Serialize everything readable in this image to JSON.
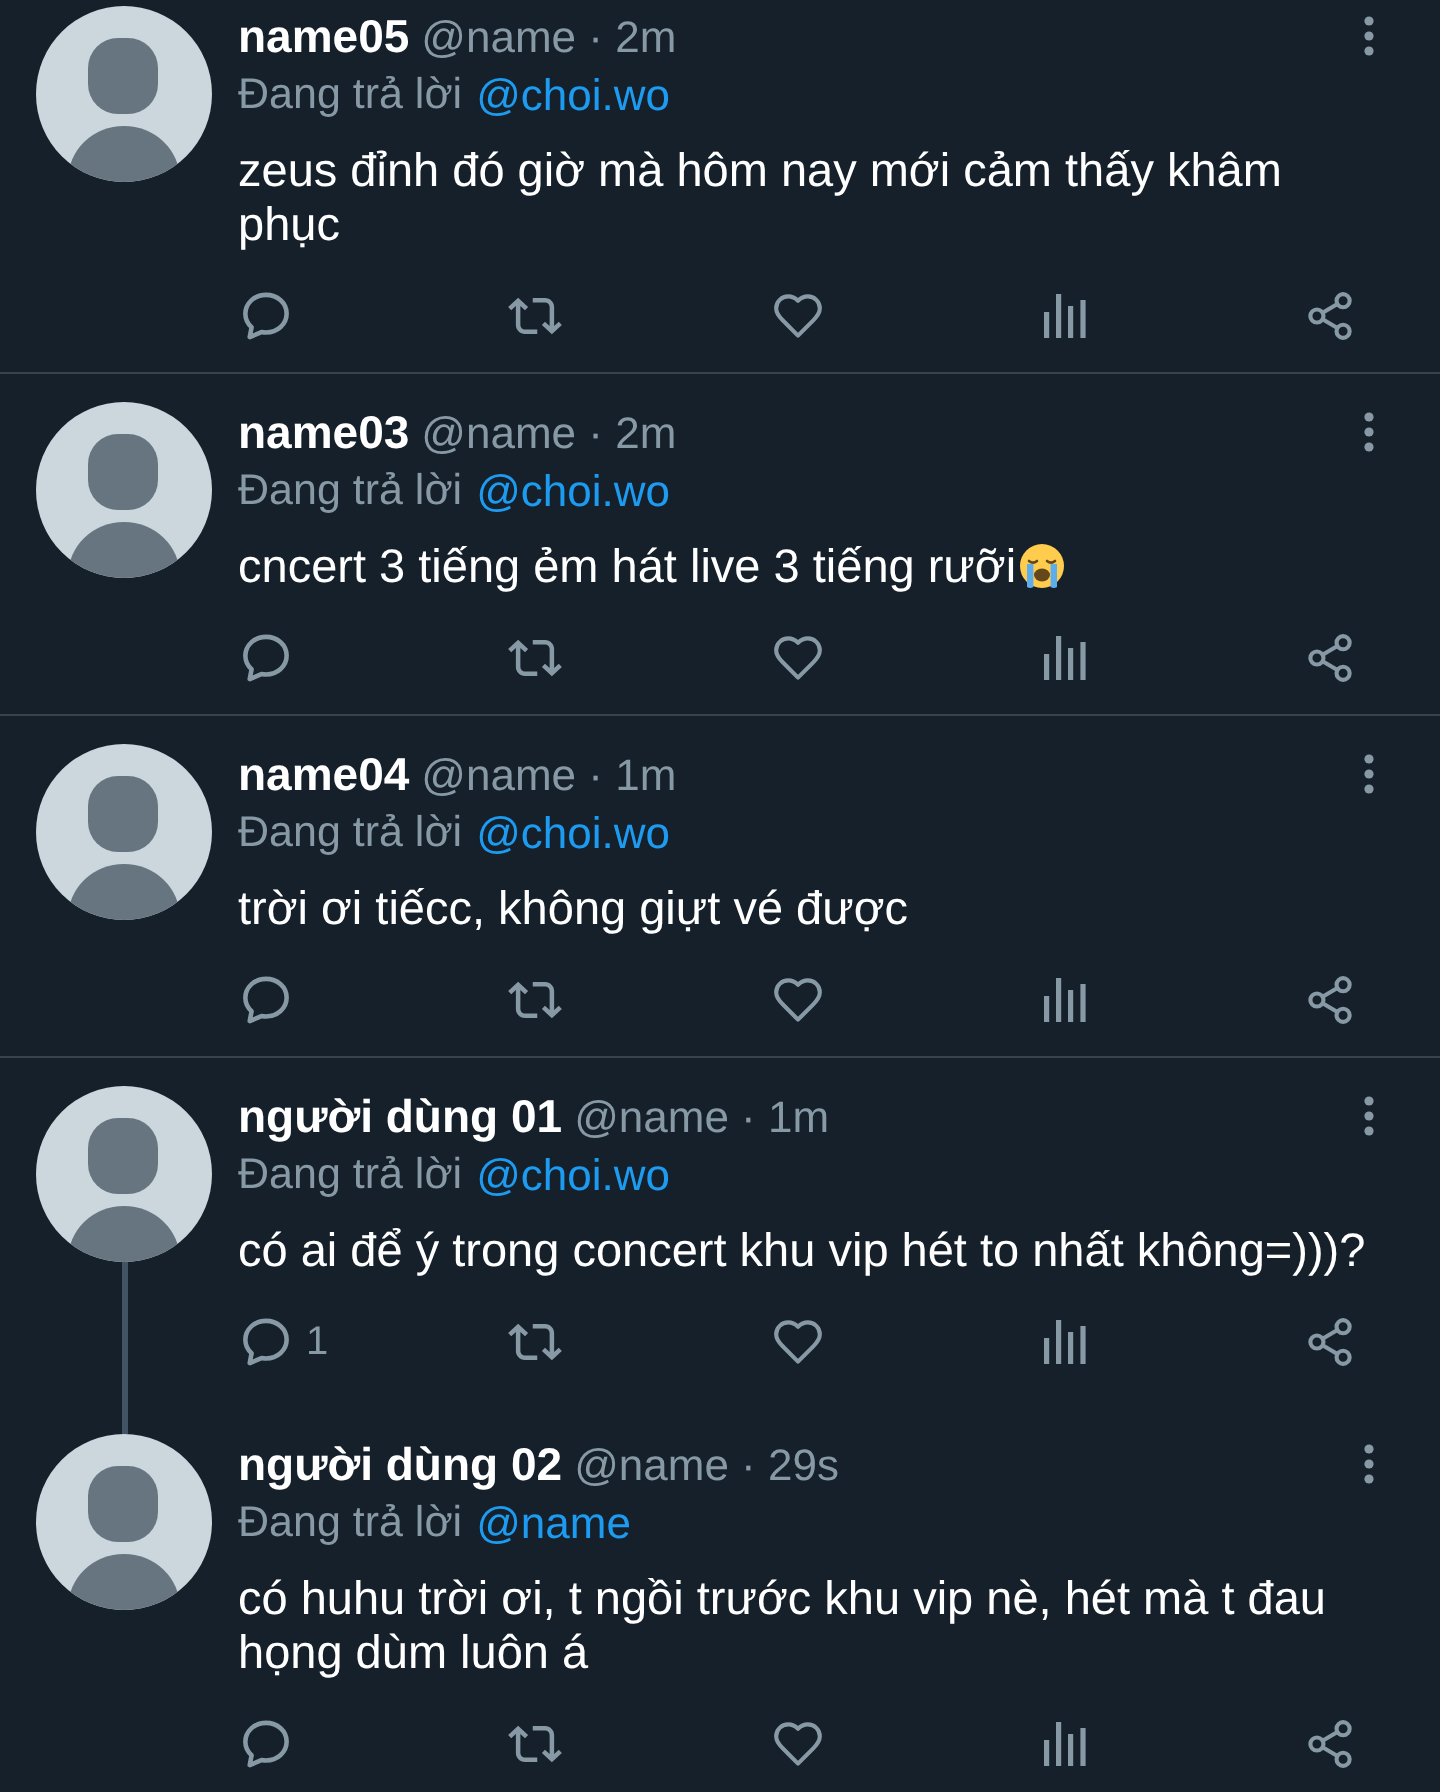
{
  "tweets": [
    {
      "name": "name05",
      "meta": "@name · 2m",
      "reply_label": "Đang trả lời",
      "reply_to": "@choi.wo",
      "text": "zeus đỉnh đó giờ mà hôm nay mới cảm thấy khâm phục",
      "trailing_emoji": false,
      "thread_line": false
    },
    {
      "name": "name03",
      "meta": "@name · 2m",
      "reply_label": "Đang trả lời",
      "reply_to": "@choi.wo",
      "text": "cncert 3 tiếng ẻm hát live 3 tiếng rưỡi",
      "trailing_emoji": true,
      "thread_line": false
    },
    {
      "name": "name04",
      "meta": "@name · 1m",
      "reply_label": "Đang trả lời",
      "reply_to": "@choi.wo",
      "text": "trời ơi tiếcc, không giựt vé được",
      "trailing_emoji": false,
      "thread_line": false
    },
    {
      "name": "người dùng 01",
      "meta": "@name · 1m",
      "reply_label": "Đang trả lời",
      "reply_to": "@choi.wo",
      "text": "có ai để ý trong concert khu vip hét to nhất không=)))?",
      "reply_count": "1",
      "trailing_emoji": false,
      "thread_line": true
    },
    {
      "name": "người dùng 02",
      "meta": "@name · 29s",
      "reply_label": "Đang trả lời",
      "reply_to": "@name",
      "text": "có huhu trời ơi, t ngồi trước khu vip nè, hét mà t đau họng dùm luôn á",
      "trailing_emoji": false,
      "thread_line": false
    }
  ]
}
